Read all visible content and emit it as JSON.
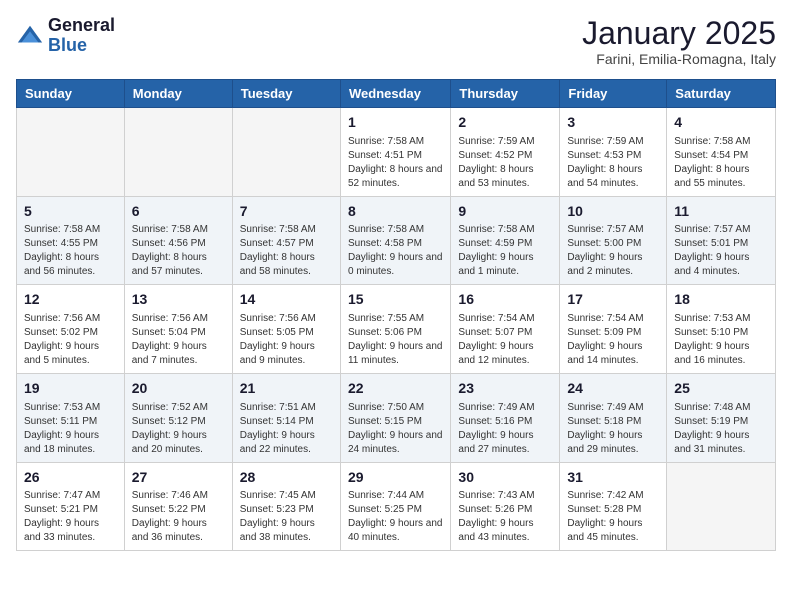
{
  "logo": {
    "general": "General",
    "blue": "Blue"
  },
  "header": {
    "month": "January 2025",
    "location": "Farini, Emilia-Romagna, Italy"
  },
  "weekdays": [
    "Sunday",
    "Monday",
    "Tuesday",
    "Wednesday",
    "Thursday",
    "Friday",
    "Saturday"
  ],
  "weeks": [
    [
      {
        "day": "",
        "sunrise": "",
        "sunset": "",
        "daylight": "",
        "empty": true
      },
      {
        "day": "",
        "sunrise": "",
        "sunset": "",
        "daylight": "",
        "empty": true
      },
      {
        "day": "",
        "sunrise": "",
        "sunset": "",
        "daylight": "",
        "empty": true
      },
      {
        "day": "1",
        "sunrise": "Sunrise: 7:58 AM",
        "sunset": "Sunset: 4:51 PM",
        "daylight": "Daylight: 8 hours and 52 minutes.",
        "empty": false
      },
      {
        "day": "2",
        "sunrise": "Sunrise: 7:59 AM",
        "sunset": "Sunset: 4:52 PM",
        "daylight": "Daylight: 8 hours and 53 minutes.",
        "empty": false
      },
      {
        "day": "3",
        "sunrise": "Sunrise: 7:59 AM",
        "sunset": "Sunset: 4:53 PM",
        "daylight": "Daylight: 8 hours and 54 minutes.",
        "empty": false
      },
      {
        "day": "4",
        "sunrise": "Sunrise: 7:58 AM",
        "sunset": "Sunset: 4:54 PM",
        "daylight": "Daylight: 8 hours and 55 minutes.",
        "empty": false
      }
    ],
    [
      {
        "day": "5",
        "sunrise": "Sunrise: 7:58 AM",
        "sunset": "Sunset: 4:55 PM",
        "daylight": "Daylight: 8 hours and 56 minutes.",
        "empty": false
      },
      {
        "day": "6",
        "sunrise": "Sunrise: 7:58 AM",
        "sunset": "Sunset: 4:56 PM",
        "daylight": "Daylight: 8 hours and 57 minutes.",
        "empty": false
      },
      {
        "day": "7",
        "sunrise": "Sunrise: 7:58 AM",
        "sunset": "Sunset: 4:57 PM",
        "daylight": "Daylight: 8 hours and 58 minutes.",
        "empty": false
      },
      {
        "day": "8",
        "sunrise": "Sunrise: 7:58 AM",
        "sunset": "Sunset: 4:58 PM",
        "daylight": "Daylight: 9 hours and 0 minutes.",
        "empty": false
      },
      {
        "day": "9",
        "sunrise": "Sunrise: 7:58 AM",
        "sunset": "Sunset: 4:59 PM",
        "daylight": "Daylight: 9 hours and 1 minute.",
        "empty": false
      },
      {
        "day": "10",
        "sunrise": "Sunrise: 7:57 AM",
        "sunset": "Sunset: 5:00 PM",
        "daylight": "Daylight: 9 hours and 2 minutes.",
        "empty": false
      },
      {
        "day": "11",
        "sunrise": "Sunrise: 7:57 AM",
        "sunset": "Sunset: 5:01 PM",
        "daylight": "Daylight: 9 hours and 4 minutes.",
        "empty": false
      }
    ],
    [
      {
        "day": "12",
        "sunrise": "Sunrise: 7:56 AM",
        "sunset": "Sunset: 5:02 PM",
        "daylight": "Daylight: 9 hours and 5 minutes.",
        "empty": false
      },
      {
        "day": "13",
        "sunrise": "Sunrise: 7:56 AM",
        "sunset": "Sunset: 5:04 PM",
        "daylight": "Daylight: 9 hours and 7 minutes.",
        "empty": false
      },
      {
        "day": "14",
        "sunrise": "Sunrise: 7:56 AM",
        "sunset": "Sunset: 5:05 PM",
        "daylight": "Daylight: 9 hours and 9 minutes.",
        "empty": false
      },
      {
        "day": "15",
        "sunrise": "Sunrise: 7:55 AM",
        "sunset": "Sunset: 5:06 PM",
        "daylight": "Daylight: 9 hours and 11 minutes.",
        "empty": false
      },
      {
        "day": "16",
        "sunrise": "Sunrise: 7:54 AM",
        "sunset": "Sunset: 5:07 PM",
        "daylight": "Daylight: 9 hours and 12 minutes.",
        "empty": false
      },
      {
        "day": "17",
        "sunrise": "Sunrise: 7:54 AM",
        "sunset": "Sunset: 5:09 PM",
        "daylight": "Daylight: 9 hours and 14 minutes.",
        "empty": false
      },
      {
        "day": "18",
        "sunrise": "Sunrise: 7:53 AM",
        "sunset": "Sunset: 5:10 PM",
        "daylight": "Daylight: 9 hours and 16 minutes.",
        "empty": false
      }
    ],
    [
      {
        "day": "19",
        "sunrise": "Sunrise: 7:53 AM",
        "sunset": "Sunset: 5:11 PM",
        "daylight": "Daylight: 9 hours and 18 minutes.",
        "empty": false
      },
      {
        "day": "20",
        "sunrise": "Sunrise: 7:52 AM",
        "sunset": "Sunset: 5:12 PM",
        "daylight": "Daylight: 9 hours and 20 minutes.",
        "empty": false
      },
      {
        "day": "21",
        "sunrise": "Sunrise: 7:51 AM",
        "sunset": "Sunset: 5:14 PM",
        "daylight": "Daylight: 9 hours and 22 minutes.",
        "empty": false
      },
      {
        "day": "22",
        "sunrise": "Sunrise: 7:50 AM",
        "sunset": "Sunset: 5:15 PM",
        "daylight": "Daylight: 9 hours and 24 minutes.",
        "empty": false
      },
      {
        "day": "23",
        "sunrise": "Sunrise: 7:49 AM",
        "sunset": "Sunset: 5:16 PM",
        "daylight": "Daylight: 9 hours and 27 minutes.",
        "empty": false
      },
      {
        "day": "24",
        "sunrise": "Sunrise: 7:49 AM",
        "sunset": "Sunset: 5:18 PM",
        "daylight": "Daylight: 9 hours and 29 minutes.",
        "empty": false
      },
      {
        "day": "25",
        "sunrise": "Sunrise: 7:48 AM",
        "sunset": "Sunset: 5:19 PM",
        "daylight": "Daylight: 9 hours and 31 minutes.",
        "empty": false
      }
    ],
    [
      {
        "day": "26",
        "sunrise": "Sunrise: 7:47 AM",
        "sunset": "Sunset: 5:21 PM",
        "daylight": "Daylight: 9 hours and 33 minutes.",
        "empty": false
      },
      {
        "day": "27",
        "sunrise": "Sunrise: 7:46 AM",
        "sunset": "Sunset: 5:22 PM",
        "daylight": "Daylight: 9 hours and 36 minutes.",
        "empty": false
      },
      {
        "day": "28",
        "sunrise": "Sunrise: 7:45 AM",
        "sunset": "Sunset: 5:23 PM",
        "daylight": "Daylight: 9 hours and 38 minutes.",
        "empty": false
      },
      {
        "day": "29",
        "sunrise": "Sunrise: 7:44 AM",
        "sunset": "Sunset: 5:25 PM",
        "daylight": "Daylight: 9 hours and 40 minutes.",
        "empty": false
      },
      {
        "day": "30",
        "sunrise": "Sunrise: 7:43 AM",
        "sunset": "Sunset: 5:26 PM",
        "daylight": "Daylight: 9 hours and 43 minutes.",
        "empty": false
      },
      {
        "day": "31",
        "sunrise": "Sunrise: 7:42 AM",
        "sunset": "Sunset: 5:28 PM",
        "daylight": "Daylight: 9 hours and 45 minutes.",
        "empty": false
      },
      {
        "day": "",
        "sunrise": "",
        "sunset": "",
        "daylight": "",
        "empty": true
      }
    ]
  ]
}
